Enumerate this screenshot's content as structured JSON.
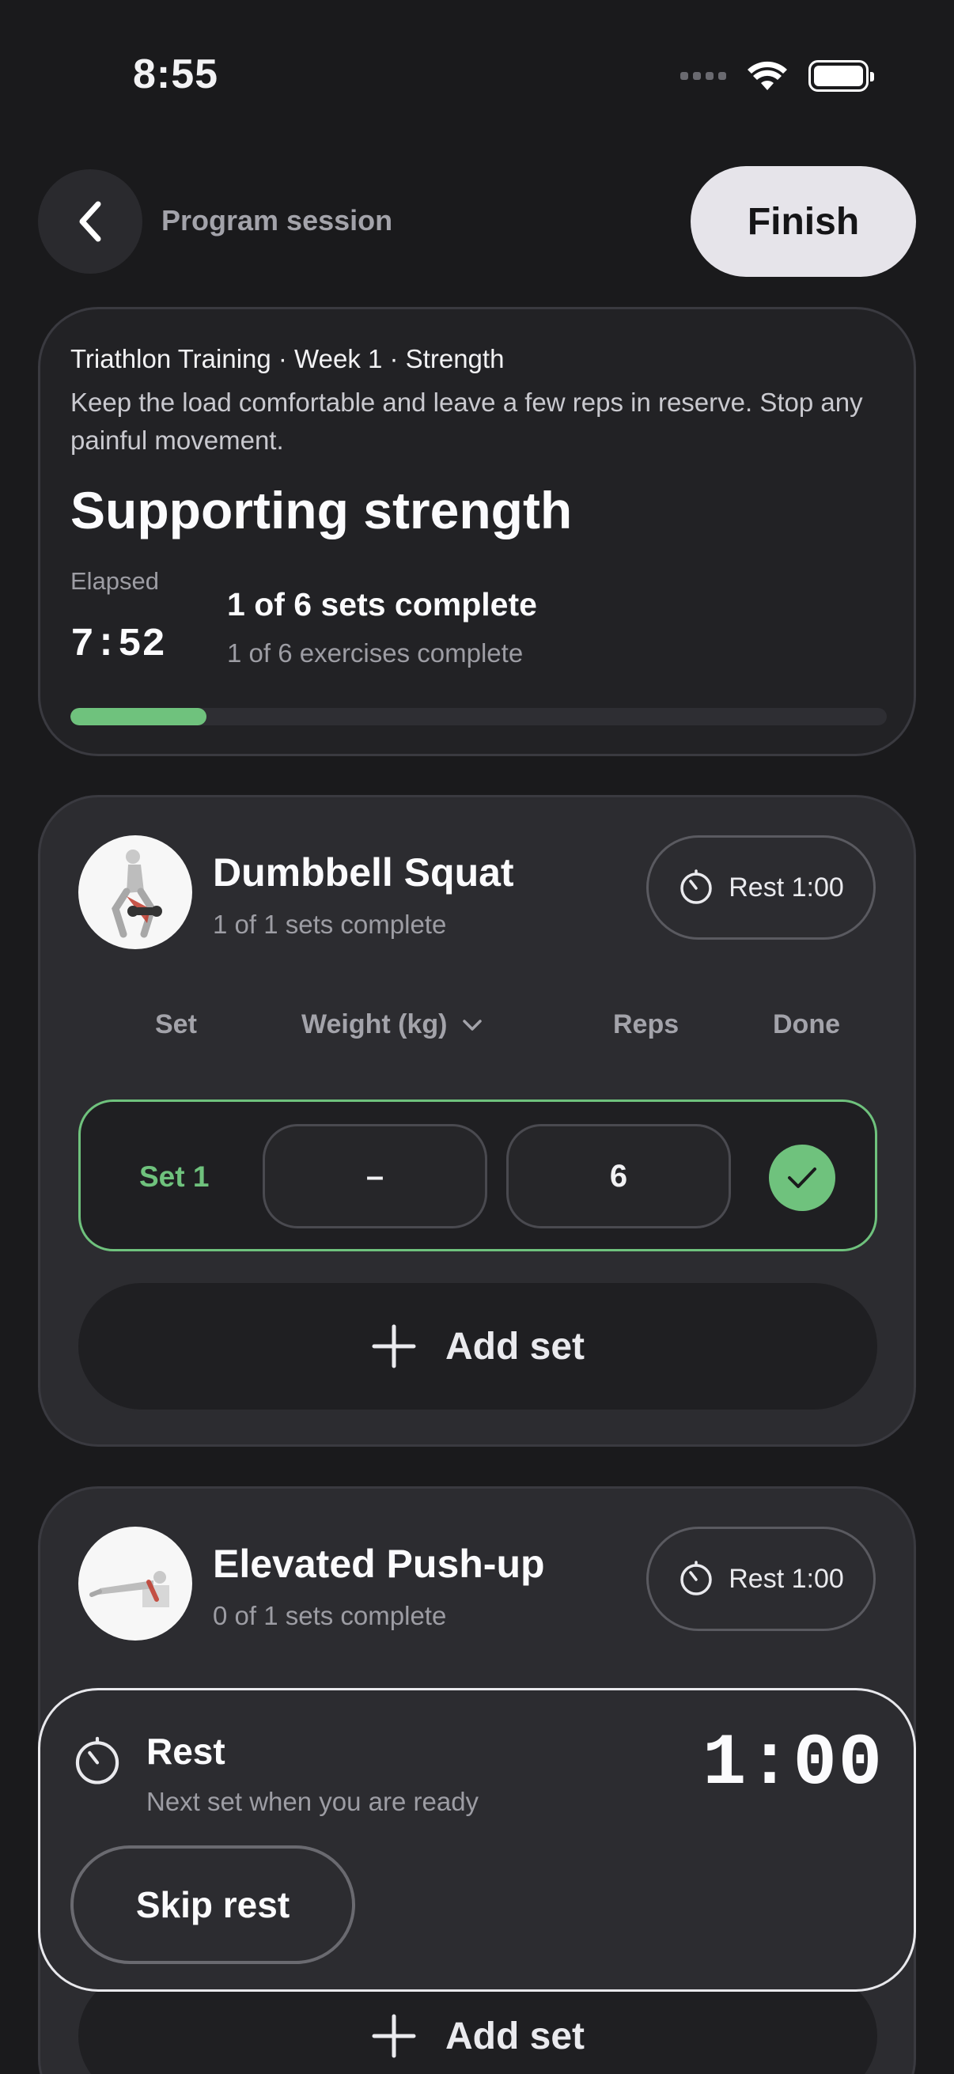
{
  "status_bar": {
    "time": "8:55"
  },
  "header": {
    "title": "Program session",
    "finish_label": "Finish"
  },
  "summary": {
    "program_line": "Triathlon Training · Week 1 · Strength",
    "note": "Keep the load comfortable and leave a few reps in reserve. Stop any painful movement.",
    "session_title": "Supporting strength",
    "elapsed_label": "Elapsed",
    "elapsed_value": "7:52",
    "sets_complete": "1 of 6 sets complete",
    "exercises_complete": "1 of 6 exercises complete",
    "progress_fraction": 0.167
  },
  "exercises": [
    {
      "name": "Dumbbell Squat",
      "subtitle": "1 of 1 sets complete",
      "rest_label": "Rest 1:00",
      "columns": {
        "set": "Set",
        "weight": "Weight (kg)",
        "reps": "Reps",
        "done": "Done"
      },
      "sets": [
        {
          "label": "Set 1",
          "weight": "–",
          "reps": "6",
          "done": true
        }
      ],
      "add_set_label": "Add set"
    },
    {
      "name": "Elevated Push-up",
      "subtitle": "0 of 1 sets complete",
      "rest_label": "Rest 1:00",
      "add_set_label": "Add set"
    }
  ],
  "rest_overlay": {
    "title": "Rest",
    "subtitle": "Next set when you are ready",
    "time": "1:00",
    "skip_label": "Skip rest"
  },
  "colors": {
    "accent": "#6fc27d",
    "background": "#1a1a1c",
    "card": "#2c2c30"
  }
}
